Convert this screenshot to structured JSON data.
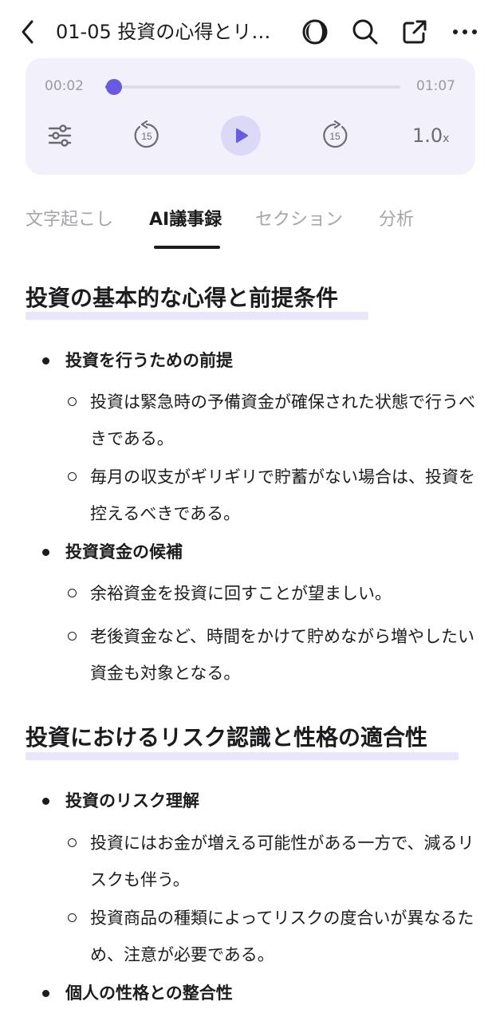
{
  "header": {
    "title": "01-05 投資の心得とリ…",
    "icons": [
      "back-chevron-icon",
      "theme-toggle-icon",
      "search-icon",
      "share-icon",
      "more-icon"
    ]
  },
  "player": {
    "current_time": "00:02",
    "total_time": "01:07",
    "progress": 0.03,
    "speed_value": "1.0",
    "speed_unit": "x",
    "accent": "#6a5ae0"
  },
  "tabs": {
    "transcript": "文字起こし",
    "ai_minutes": "AI議事録",
    "sections": "セクション",
    "analysis": "分析",
    "active": "AI議事録"
  },
  "sections": [
    {
      "title": "投資の基本的な心得と前提条件",
      "items": [
        {
          "label": "投資を行うための前提",
          "subs": [
            "投資は緊急時の予備資金が確保された状態で行うべきである。",
            "毎月の収支がギリギリで貯蓄がない場合は、投資を控えるべきである。"
          ]
        },
        {
          "label": "投資資金の候補",
          "subs": [
            "余裕資金を投資に回すことが望ましい。",
            "老後資金など、時間をかけて貯めながら増やしたい資金も対象となる。"
          ]
        }
      ]
    },
    {
      "title": "投資におけるリスク認識と性格の適合性",
      "items": [
        {
          "label": "投資のリスク理解",
          "subs": [
            "投資にはお金が増える可能性がある一方で、減るリスクも伴う。",
            "投資商品の種類によってリスクの度合いが異なるため、注意が必要である。"
          ]
        },
        {
          "label": "個人の性格との整合性",
          "subs": []
        }
      ]
    }
  ]
}
